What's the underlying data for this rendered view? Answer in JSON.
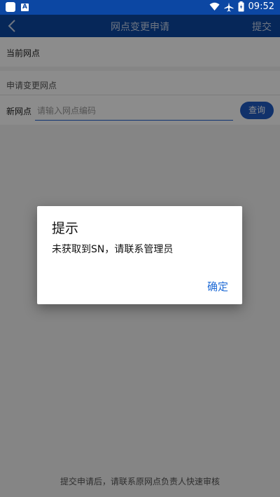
{
  "status_bar": {
    "time": "09:52",
    "icons": [
      "notification-square-icon",
      "a-badge-icon",
      "wifi-icon",
      "airplane-icon",
      "battery-icon"
    ]
  },
  "app_bar": {
    "back_icon": "chevron-left-icon",
    "title": "网点变更申请",
    "submit_label": "提交"
  },
  "current_outlet": {
    "label": "当前网点"
  },
  "change_section": {
    "header": "申请变更网点",
    "new_outlet_label": "新网点",
    "input_placeholder": "请输入网点编码",
    "input_value": "",
    "query_label": "查询"
  },
  "footer": {
    "note": "提交申请后，请联系原网点负责人快速审核"
  },
  "dialog": {
    "title": "提示",
    "message": "未获取到SN，请联系管理员",
    "ok_label": "确定"
  },
  "colors": {
    "primary": "#0c47a3",
    "accent": "#1e6ad6"
  }
}
